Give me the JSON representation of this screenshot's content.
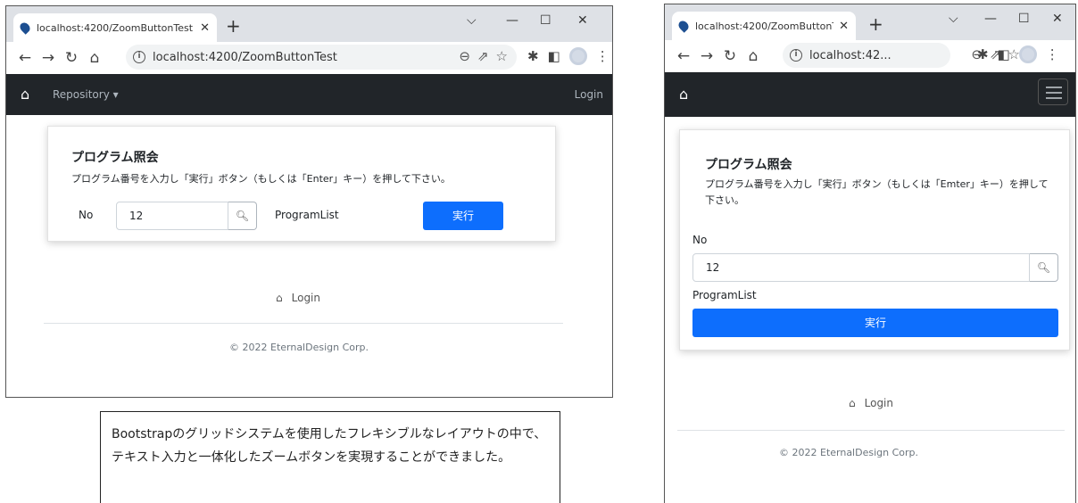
{
  "left_window": {
    "tab_title": "localhost:4200/ZoomButtonTest",
    "url": "localhost:4200/ZoomButtonTest",
    "navbar": {
      "home_icon": "home-icon",
      "repository": "Repository ▾",
      "login": "Login"
    },
    "card": {
      "title": "プログラム照会",
      "description": "プログラム番号を入力し「実行」ボタン（もしくは「Enter」キー）を押して下さい。",
      "no_label": "No",
      "input_value": "12",
      "program_list": "ProgramList",
      "exec_button": "実行"
    },
    "footer": {
      "login": "Login",
      "copyright": "© 2022 EternalDesign Corp."
    }
  },
  "right_window": {
    "tab_title": "localhost:4200/ZoomButtonTe",
    "url": "localhost:42...",
    "card": {
      "title": "プログラム照会",
      "description": "プログラム番号を入力し「実行」ボタン（もしくは「Emter」キー）を押して下さい。",
      "no_label": "No",
      "input_value": "12",
      "program_list": "ProgramList",
      "exec_button": "実行"
    },
    "footer": {
      "login": "Login",
      "copyright": "© 2022 EternalDesign Corp."
    }
  },
  "caption": "Bootstrapのグリッドシステムを使用したフレキシブルなレイアウトの中で、テキスト入力と一体化したズームボタンを実現することができました。",
  "colors": {
    "navbar": "#212529",
    "primary": "#0d6efd",
    "tabstrip": "#dee1e6"
  }
}
